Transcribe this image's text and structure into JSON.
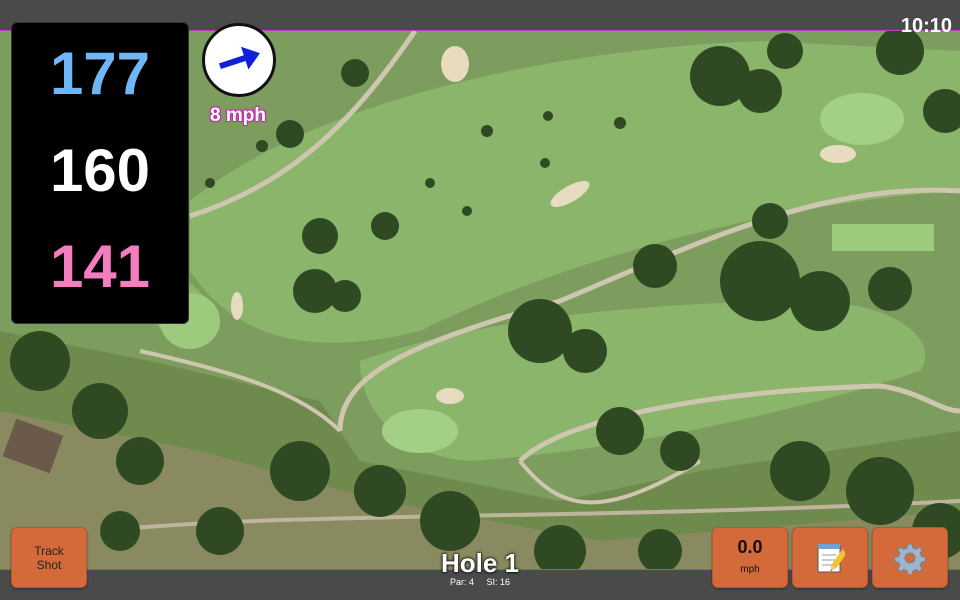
{
  "status_bar": {
    "time": "10:10"
  },
  "distances": {
    "back": "177",
    "middle": "160",
    "front": "141"
  },
  "wind": {
    "label": "8 mph",
    "direction_icon": "wind-arrow-icon"
  },
  "buttons": {
    "track_shot": [
      "Track",
      "Shot"
    ],
    "wind_value": "0.0",
    "wind_unit": "mph",
    "notes_icon": "notepad-icon",
    "settings_icon": "gear-icon"
  },
  "hole": {
    "title": "Hole 1",
    "par": "Par: 4",
    "stroke_index": "SI: 16"
  },
  "colors": {
    "back": "#6eb6f6",
    "middle": "#ffffff",
    "front": "#f47dc0",
    "button": "#d46a3a",
    "wind_label_outline": "#c030b0"
  }
}
